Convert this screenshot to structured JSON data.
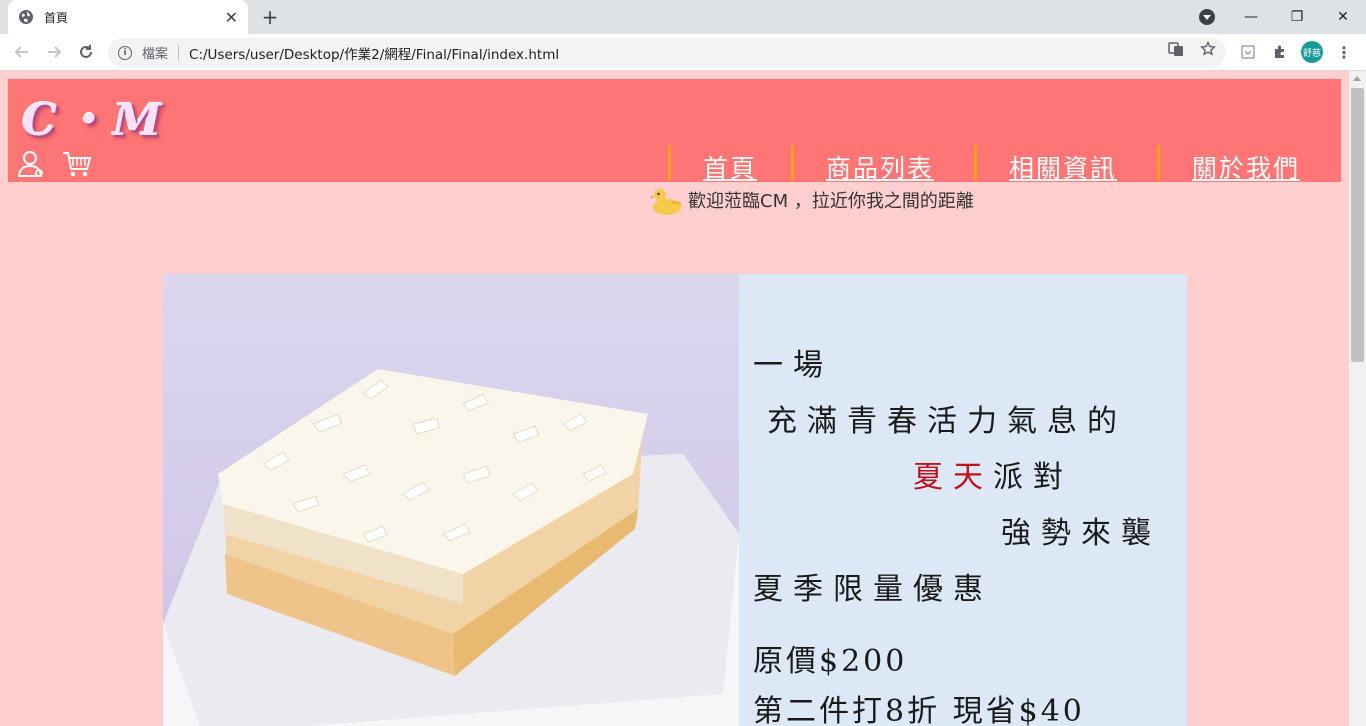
{
  "browser": {
    "tab_title": "首頁",
    "tab_close": "✕",
    "new_tab": "+",
    "window_controls": {
      "minimize": "—",
      "restore": "❐",
      "close": "✕"
    },
    "security_label": "檔案",
    "url": "C:/Users/user/Desktop/作業2/網程/Final/Final/index.html",
    "profile_label": "舒慈"
  },
  "site": {
    "logo": "C・M",
    "nav": [
      {
        "label": "首頁"
      },
      {
        "label": "商品列表"
      },
      {
        "label": "相關資訊"
      },
      {
        "label": "關於我們"
      }
    ],
    "welcome": "歡迎蒞臨CM ，拉近你我之間的距離",
    "colors": {
      "header": "#ff7575",
      "page": "#ffcfcf",
      "nav_divider": "#ff9f1a",
      "highlight": "#c4101a"
    }
  },
  "banner": {
    "line1": "一場",
    "line2": "充滿青春活力氣息的",
    "line3_highlight": "夏天",
    "line3_rest": "派對",
    "line4": "強勢來襲",
    "line5": "夏季限量優惠",
    "line6": "原價$200",
    "line7": "第二件打8折 現省$40"
  }
}
